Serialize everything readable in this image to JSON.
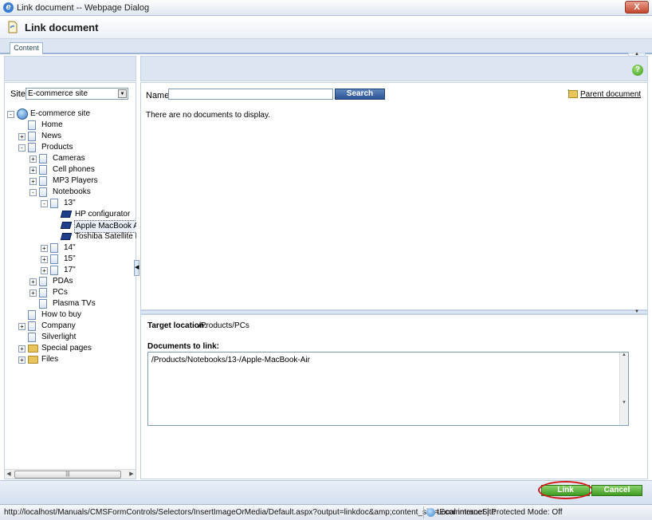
{
  "window": {
    "title": "Link document -- Webpage Dialog",
    "close_label": "X"
  },
  "dialog": {
    "title": "Link document"
  },
  "tabs": [
    {
      "label": "Content"
    }
  ],
  "site": {
    "label": "Site:",
    "selected": "E-commerce site"
  },
  "tree": [
    {
      "label": "E-commerce site",
      "icon": "globe-icon",
      "depth": 0,
      "expander": "-"
    },
    {
      "label": "Home",
      "icon": "page-icon",
      "depth": 1,
      "expander": ""
    },
    {
      "label": "News",
      "icon": "page-icon",
      "depth": 1,
      "expander": "+"
    },
    {
      "label": "Products",
      "icon": "page-icon",
      "depth": 1,
      "expander": "-"
    },
    {
      "label": "Cameras",
      "icon": "page-icon",
      "depth": 2,
      "expander": "+"
    },
    {
      "label": "Cell phones",
      "icon": "page-icon",
      "depth": 2,
      "expander": "+"
    },
    {
      "label": "MP3 Players",
      "icon": "page-icon",
      "depth": 2,
      "expander": "+"
    },
    {
      "label": "Notebooks",
      "icon": "page-icon",
      "depth": 2,
      "expander": "-"
    },
    {
      "label": "13\"",
      "icon": "page-icon",
      "depth": 3,
      "expander": "-"
    },
    {
      "label": "HP configurator",
      "icon": "laptop-icon",
      "depth": 4,
      "expander": ""
    },
    {
      "label": "Apple MacBook Air",
      "icon": "laptop-icon",
      "depth": 4,
      "expander": "",
      "selected": true
    },
    {
      "label": "Toshiba Satellite P",
      "icon": "laptop-icon",
      "depth": 4,
      "expander": ""
    },
    {
      "label": "14\"",
      "icon": "page-icon",
      "depth": 3,
      "expander": "+"
    },
    {
      "label": "15\"",
      "icon": "page-icon",
      "depth": 3,
      "expander": "+"
    },
    {
      "label": "17\"",
      "icon": "page-icon",
      "depth": 3,
      "expander": "+"
    },
    {
      "label": "PDAs",
      "icon": "page-icon",
      "depth": 2,
      "expander": "+"
    },
    {
      "label": "PCs",
      "icon": "page-icon",
      "depth": 2,
      "expander": "+"
    },
    {
      "label": "Plasma TVs",
      "icon": "page-icon",
      "depth": 2,
      "expander": ""
    },
    {
      "label": "How to buy",
      "icon": "page-icon",
      "depth": 1,
      "expander": ""
    },
    {
      "label": "Company",
      "icon": "page-icon",
      "depth": 1,
      "expander": "+"
    },
    {
      "label": "Silverlight",
      "icon": "page-icon",
      "depth": 1,
      "expander": ""
    },
    {
      "label": "Special pages",
      "icon": "folder-icon",
      "depth": 1,
      "expander": "+"
    },
    {
      "label": "Files",
      "icon": "folder-icon",
      "depth": 1,
      "expander": "+"
    }
  ],
  "search": {
    "name_label": "Name:",
    "name_value": "",
    "button_label": "Search"
  },
  "parent_document": {
    "label": "Parent document"
  },
  "results": {
    "empty_text": "There are no documents to display."
  },
  "target": {
    "label": "Target location:",
    "value": "/Products/PCs"
  },
  "documents": {
    "label": "Documents to link:",
    "value": "/Products/Notebooks/13-/Apple-MacBook-Air"
  },
  "buttons": {
    "link_label": "Link",
    "cancel_label": "Cancel"
  },
  "help": {
    "glyph": "?"
  },
  "statusbar": {
    "url": "http://localhost/Manuals/CMSFormControls/Selectors/InsertImageOrMedia/Default.aspx?output=linkdoc&amp;content_site=EcommerceSite",
    "zone": "Local intranet | Protected Mode: Off"
  },
  "colors": {
    "accent": "#2d5493",
    "button_green": "#3f9b22",
    "highlight": "#d11a1a",
    "panel_bg": "#dbe6f2"
  }
}
